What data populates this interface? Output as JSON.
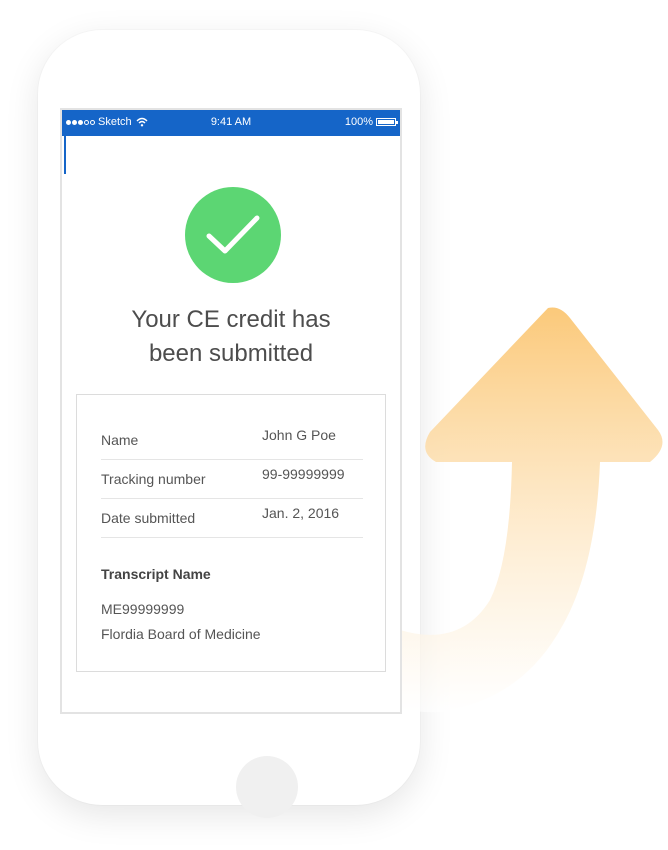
{
  "status_bar": {
    "carrier": "Sketch",
    "time": "9:41 AM",
    "battery": "100%"
  },
  "headline": {
    "line1": "Your CE credit has",
    "line2": "been submitted"
  },
  "details": [
    {
      "label": "Name",
      "value": "John G Poe"
    },
    {
      "label": "Tracking number",
      "value": "99-99999999"
    },
    {
      "label": "Date submitted",
      "value": "Jan. 2, 2016"
    }
  ],
  "transcript": {
    "title": "Transcript Name",
    "id": "ME99999999",
    "board": "Flordia Board of Medicine"
  },
  "colors": {
    "status_bar": "#1565c8",
    "success": "#5cd673",
    "arrow_top": "#fbc97a",
    "arrow_bottom": "#ffffff"
  },
  "icons": [
    "signal-dots-icon",
    "wifi-icon",
    "battery-icon",
    "checkmark-icon",
    "curved-up-arrow-icon"
  ]
}
